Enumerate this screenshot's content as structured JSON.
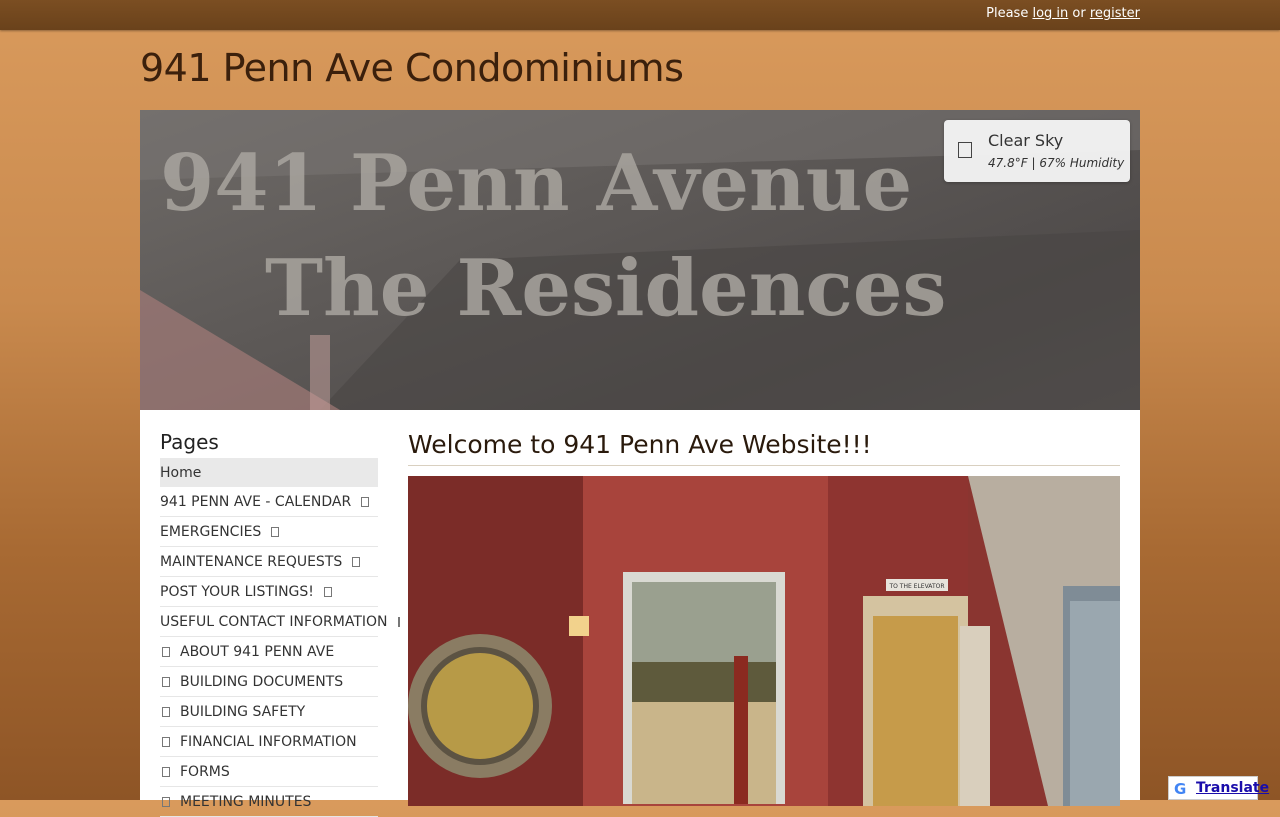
{
  "topbar": {
    "prefix": "Please",
    "login": "log in",
    "middle": "or",
    "register": "register"
  },
  "site": {
    "title": "941 Penn Ave Condominiums"
  },
  "hero": {
    "line1": "941 Penn Avenue",
    "line2": "The Residences"
  },
  "weather": {
    "condition": "Clear Sky",
    "temperature": "47.8°F",
    "separator": "|",
    "humidity": "67% Humidity"
  },
  "sidebar": {
    "heading": "Pages",
    "items": [
      {
        "label": "Home"
      },
      {
        "label": "941 PENN AVE - CALENDAR"
      },
      {
        "label": "EMERGENCIES"
      },
      {
        "label": "MAINTENANCE REQUESTS"
      },
      {
        "label": "POST YOUR LISTINGS!"
      },
      {
        "label": "USEFUL CONTACT INFORMATION"
      },
      {
        "label": "ABOUT 941 PENN AVE"
      },
      {
        "label": "BUILDING DOCUMENTS"
      },
      {
        "label": "BUILDING SAFETY"
      },
      {
        "label": "FINANCIAL INFORMATION"
      },
      {
        "label": "FORMS"
      },
      {
        "label": "MEETING MINUTES"
      }
    ]
  },
  "main": {
    "title": "Welcome to 941 Penn Ave Website!!!",
    "photo_sign": "TO THE ELEVATOR"
  },
  "translate": {
    "label": "Translate",
    "logo": "G"
  },
  "colors": {
    "topbar": "#6a421b",
    "title": "#3b200c",
    "background_top": "#d99a5c",
    "background_bottom": "#8e5526"
  }
}
